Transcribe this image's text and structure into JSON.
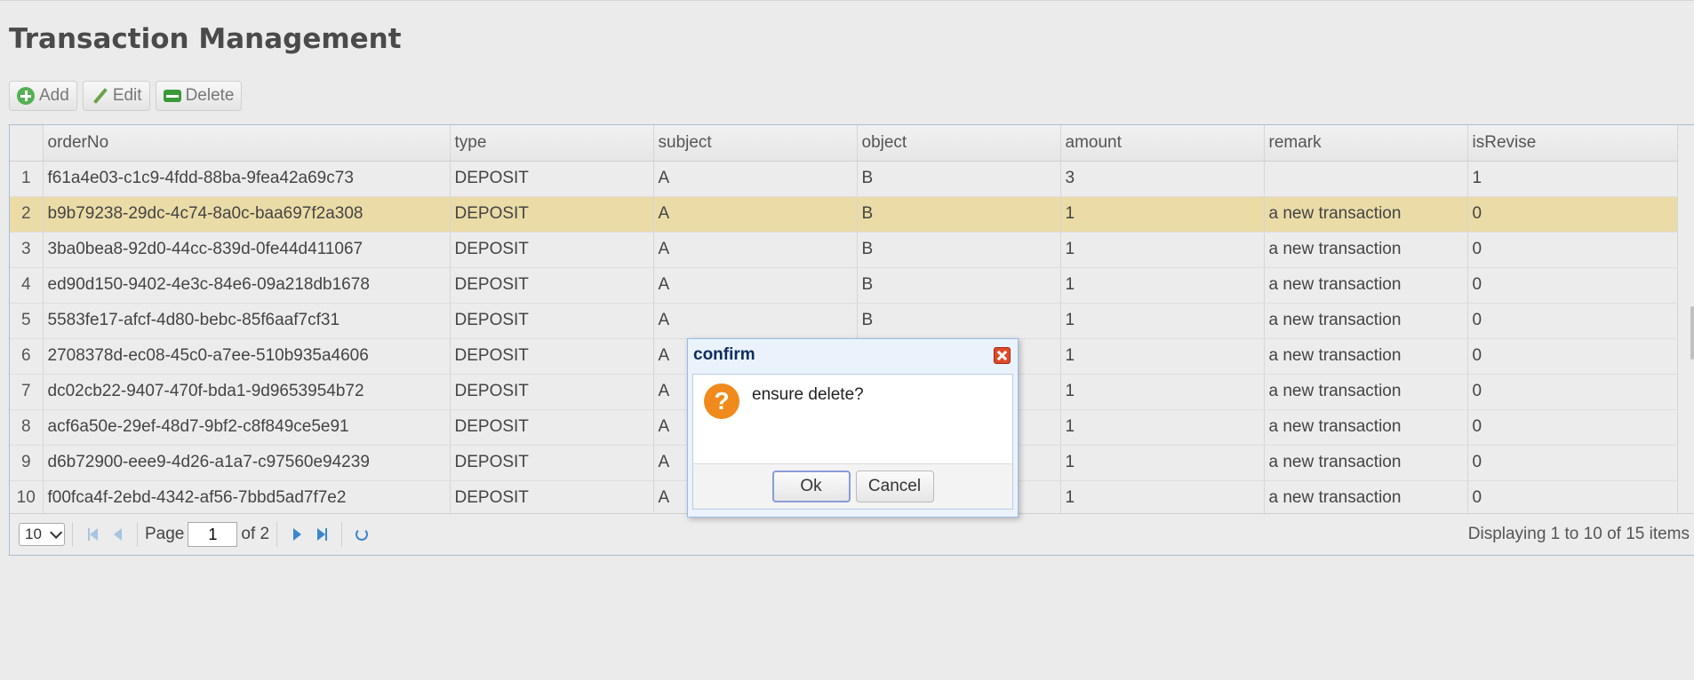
{
  "page": {
    "title": "Transaction Management"
  },
  "toolbar": {
    "add_label": "Add",
    "edit_label": "Edit",
    "delete_label": "Delete"
  },
  "grid": {
    "columns": [
      "",
      "orderNo",
      "type",
      "subject",
      "object",
      "amount",
      "remark",
      "isRevise"
    ],
    "rows": [
      {
        "n": "1",
        "orderNo": "f61a4e03-c1c9-4fdd-88ba-9fea42a69c73",
        "type": "DEPOSIT",
        "subject": "A",
        "object": "B",
        "amount": "3",
        "remark": "",
        "isRevise": "1"
      },
      {
        "n": "2",
        "orderNo": "b9b79238-29dc-4c74-8a0c-baa697f2a308",
        "type": "DEPOSIT",
        "subject": "A",
        "object": "B",
        "amount": "1",
        "remark": "a new transaction",
        "isRevise": "0"
      },
      {
        "n": "3",
        "orderNo": "3ba0bea8-92d0-44cc-839d-0fe44d411067",
        "type": "DEPOSIT",
        "subject": "A",
        "object": "B",
        "amount": "1",
        "remark": "a new transaction",
        "isRevise": "0"
      },
      {
        "n": "4",
        "orderNo": "ed90d150-9402-4e3c-84e6-09a218db1678",
        "type": "DEPOSIT",
        "subject": "A",
        "object": "B",
        "amount": "1",
        "remark": "a new transaction",
        "isRevise": "0"
      },
      {
        "n": "5",
        "orderNo": "5583fe17-afcf-4d80-bebc-85f6aaf7cf31",
        "type": "DEPOSIT",
        "subject": "A",
        "object": "B",
        "amount": "1",
        "remark": "a new transaction",
        "isRevise": "0"
      },
      {
        "n": "6",
        "orderNo": "2708378d-ec08-45c0-a7ee-510b935a4606",
        "type": "DEPOSIT",
        "subject": "A",
        "object": "",
        "amount": "1",
        "remark": "a new transaction",
        "isRevise": "0"
      },
      {
        "n": "7",
        "orderNo": "dc02cb22-9407-470f-bda1-9d9653954b72",
        "type": "DEPOSIT",
        "subject": "A",
        "object": "",
        "amount": "1",
        "remark": "a new transaction",
        "isRevise": "0"
      },
      {
        "n": "8",
        "orderNo": "acf6a50e-29ef-48d7-9bf2-c8f849ce5e91",
        "type": "DEPOSIT",
        "subject": "A",
        "object": "",
        "amount": "1",
        "remark": "a new transaction",
        "isRevise": "0"
      },
      {
        "n": "9",
        "orderNo": "d6b72900-eee9-4d26-a1a7-c97560e94239",
        "type": "DEPOSIT",
        "subject": "A",
        "object": "",
        "amount": "1",
        "remark": "a new transaction",
        "isRevise": "0"
      },
      {
        "n": "10",
        "orderNo": "f00fca4f-2ebd-4342-af56-7bbd5ad7f7e2",
        "type": "DEPOSIT",
        "subject": "A",
        "object": "",
        "amount": "1",
        "remark": "a new transaction",
        "isRevise": "0"
      }
    ],
    "selected_row": 2
  },
  "pager": {
    "page_size": "10",
    "page_label": "Page",
    "page_value": "1",
    "of_label": "of 2",
    "info": "Displaying 1 to 10 of 15 items"
  },
  "dialog": {
    "title": "confirm",
    "message": "ensure delete?",
    "icon": "?",
    "ok_label": "Ok",
    "cancel_label": "Cancel"
  },
  "colors": {
    "selected_row": "#ebdca7",
    "dialog_border": "#99bbe8",
    "question_icon": "#f08a1c",
    "close_button": "#de4b2a"
  }
}
